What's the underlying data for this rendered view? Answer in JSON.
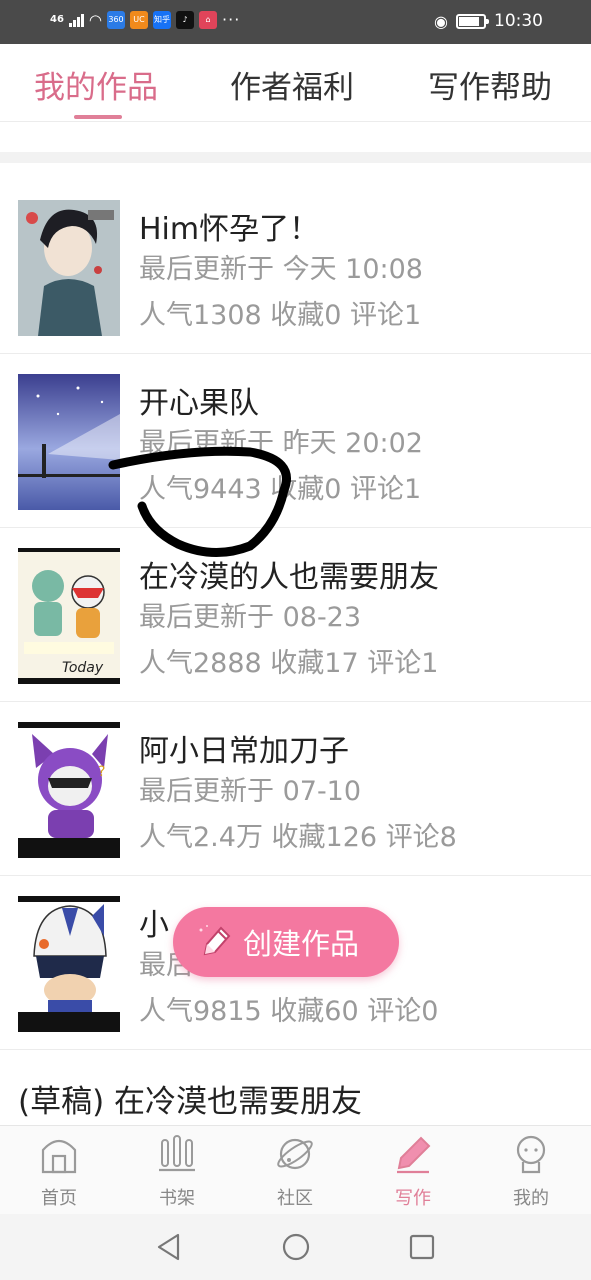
{
  "status_bar": {
    "network": "46",
    "apps": [
      "360",
      "UC",
      "知乎",
      "♪",
      "⌂"
    ],
    "app_colors": [
      "#2b7be6",
      "#f08a1c",
      "#1772f6",
      "#111111",
      "#e0445a"
    ],
    "more": "···",
    "time": "10:30",
    "battery_level": 0.85
  },
  "tabs": {
    "items": [
      "我的作品",
      "作者福利",
      "写作帮助"
    ],
    "active_index": 0
  },
  "works": [
    {
      "title": "Him怀孕了！",
      "updated": "最后更新于 今天 10:08",
      "stats": "人气1308 收藏0 评论1"
    },
    {
      "title": "开心果队",
      "updated": "最后更新于 昨天 20:02",
      "stats": "人气9443 收藏0 评论1"
    },
    {
      "title": "在冷漠的人也需要朋友",
      "updated": "最后更新于 08-23",
      "stats": "人气2888 收藏17 评论1",
      "cover_text": "Today"
    },
    {
      "title": "阿小日常加刀子",
      "updated": "最后更新于 07-10",
      "stats": "人气2.4万 收藏126 评论8"
    },
    {
      "title": "小",
      "updated": "最后",
      "stats": "人气9815 收藏60 评论0"
    }
  ],
  "draft": {
    "label": "(草稿) 在冷漠也需要朋友"
  },
  "fab": {
    "label": "创建作品"
  },
  "bottom_nav": {
    "items": [
      "首页",
      "书架",
      "社区",
      "写作",
      "我的"
    ],
    "active_index": 3
  },
  "colors": {
    "accent": "#e07f98",
    "fab": "#f478a0",
    "status_bar": "#4a4a4a",
    "muted_text": "#9a9a9a"
  }
}
